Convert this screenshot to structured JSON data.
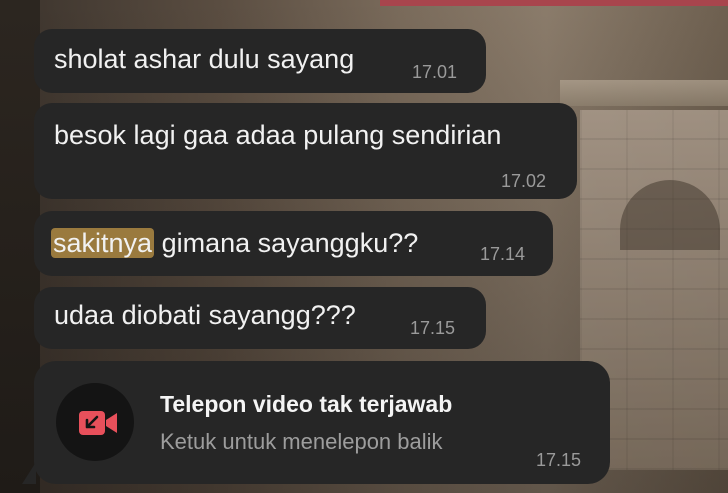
{
  "messages": [
    {
      "text": "sholat ashar dulu sayang",
      "time": "17.01"
    },
    {
      "text": "besok lagi gaa adaa pulang sendirian",
      "time": "17.02"
    },
    {
      "highlighted": "sakitnya",
      "rest": " gimana sayanggku??",
      "time": "17.14"
    },
    {
      "text": "udaa diobati sayangg???",
      "time": "17.15"
    }
  ],
  "missed_call": {
    "icon": "missed-video-call-icon",
    "title": "Telepon video tak terjawab",
    "subtitle": "Ketuk untuk menelepon balik",
    "time": "17.15"
  },
  "colors": {
    "bubble": "#262626",
    "highlight": "#9a7a3e",
    "missed_call_icon": "#e8505b"
  }
}
